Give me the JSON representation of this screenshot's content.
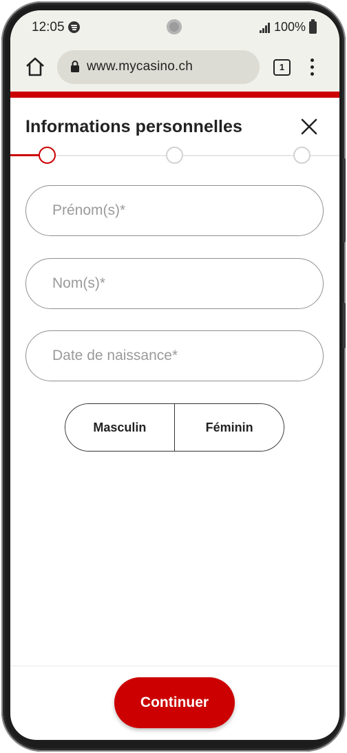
{
  "status_bar": {
    "time": "12:05",
    "battery": "100%",
    "icons": [
      "spotify-icon",
      "signal-icon",
      "battery-icon"
    ]
  },
  "browser": {
    "url": "www.mycasino.ch",
    "tab_count": "1",
    "icons": [
      "home-icon",
      "lock-icon",
      "tabs-icon",
      "more-vert-icon"
    ]
  },
  "form": {
    "title": "Informations personnelles",
    "close_icon": "close-icon",
    "steps": {
      "total": 3,
      "current": 1
    },
    "fields": {
      "first_name": {
        "value": "",
        "placeholder": "Prénom(s)*"
      },
      "last_name": {
        "value": "",
        "placeholder": "Nom(s)*"
      },
      "birth_date": {
        "value": "",
        "placeholder": "Date de naissance*"
      }
    },
    "gender": {
      "male_label": "Masculin",
      "female_label": "Féminin"
    },
    "continue_label": "Continuer"
  },
  "colors": {
    "brand_red": "#cc0000",
    "chrome_bg": "#f1f1ec",
    "url_bar_bg": "#dcdcd4",
    "field_border": "#8f8f8f",
    "placeholder": "#9a9a9a"
  }
}
